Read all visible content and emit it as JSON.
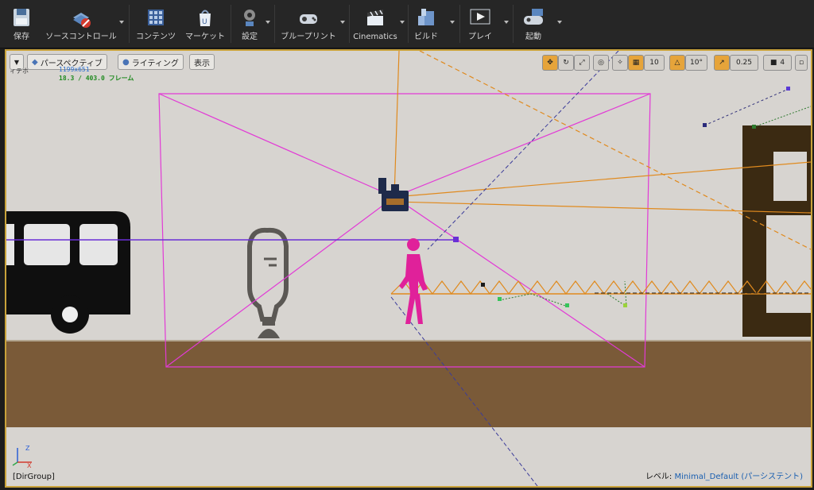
{
  "toolbar": {
    "save": "保存",
    "source_control": "ソースコントロール",
    "content": "コンテンツ",
    "marketplace": "マーケット",
    "settings": "設定",
    "blueprints": "ブループリント",
    "cinematics": "Cinematics",
    "build": "ビルド",
    "play": "プレイ",
    "launch": "起動"
  },
  "viewport": {
    "perspective": "パースペクティブ",
    "lighting": "ライティング",
    "show": "表示",
    "overlay_text": "ィテホ",
    "resolution": "1199x651",
    "frame_info": "18.3 / 403.0 フレーム",
    "grid_snap": "10",
    "rot_snap": "10°",
    "scale_snap": "0.25",
    "cam_speed": "4",
    "group_label": "[DirGroup]",
    "level_label": "レベル:",
    "level_name": "Minimal_Default (パーシステント)",
    "axis_z": "Z",
    "axis_x": "X"
  },
  "colors": {
    "toolbar_bg": "#262626",
    "viewport_border": "#c9a23a",
    "wall": "#d7d4d0",
    "floor": "#7a5a38",
    "camera_frustum": "#e23ad6",
    "spline_orange": "#e08a1e",
    "spline_purple": "#6a2fd6",
    "character": "#e0219a",
    "frame_shape": "#3b2a12"
  },
  "icons": [
    "save-icon",
    "source-control-icon",
    "content-icon",
    "marketplace-icon",
    "settings-icon",
    "blueprints-icon",
    "cinematics-icon",
    "build-icon",
    "play-icon",
    "launch-icon"
  ]
}
